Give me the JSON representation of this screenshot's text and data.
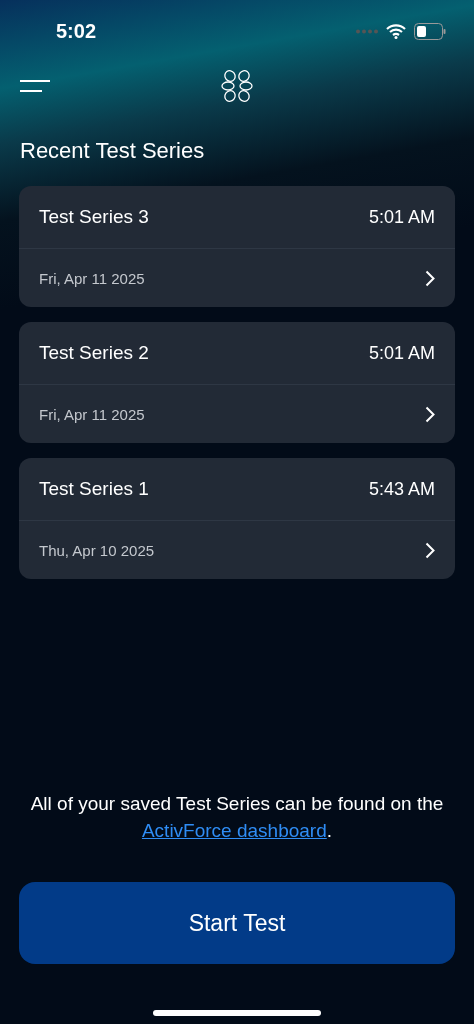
{
  "status_bar": {
    "time": "5:02"
  },
  "section_title": "Recent Test Series",
  "series": [
    {
      "name": "Test Series 3",
      "time": "5:01 AM",
      "date": "Fri, Apr 11 2025"
    },
    {
      "name": "Test Series 2",
      "time": "5:01 AM",
      "date": "Fri, Apr 11 2025"
    },
    {
      "name": "Test Series 1",
      "time": "5:43 AM",
      "date": "Thu, Apr 10 2025"
    }
  ],
  "note": {
    "text_before": "All of your saved Test Series can be found on the ",
    "link": "ActivForce dashboard",
    "text_after": "."
  },
  "primary_button": "Start Test"
}
